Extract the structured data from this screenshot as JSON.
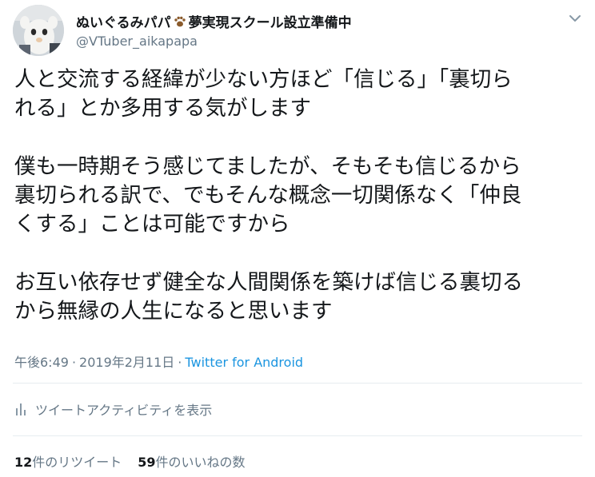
{
  "user": {
    "display_name": "ぬいぐるみパパ",
    "display_name_suffix": "夢実現スクール設立準備中",
    "handle": "@VTuber_aikapapa",
    "badge_icon": "paw-icon",
    "avatar": "avatar-plush-doll"
  },
  "menu_icon": "chevron-down-icon",
  "tweet": {
    "paragraphs": [
      [
        "人と交流する経緯が少ない方ほど「信じる」「裏切ら",
        "れる」とか多用する気がします"
      ],
      [
        "僕も一時期そう感じてましたが、そもそも信じるから",
        "裏切られる訳で、でもそんな概念一切関係なく「仲良",
        "くする」ことは可能ですから"
      ],
      [
        "お互い依存せず健全な人間関係を築けば信じる裏切る",
        "から無縁の人生になると思います"
      ]
    ]
  },
  "meta": {
    "time": "午後6:49",
    "separator": "·",
    "date": "2019年2月11日",
    "source": "Twitter for Android"
  },
  "activity": {
    "label": "ツイートアクティビティを表示",
    "icon": "bar-chart-icon"
  },
  "stats": {
    "retweet_count": "12",
    "retweet_label": "件のリツイート",
    "like_count": "59",
    "like_label": "件のいいねの数"
  },
  "colors": {
    "text": "#14171a",
    "secondary": "#657786",
    "link": "#1b95e0",
    "divider": "#e6ecf0"
  }
}
